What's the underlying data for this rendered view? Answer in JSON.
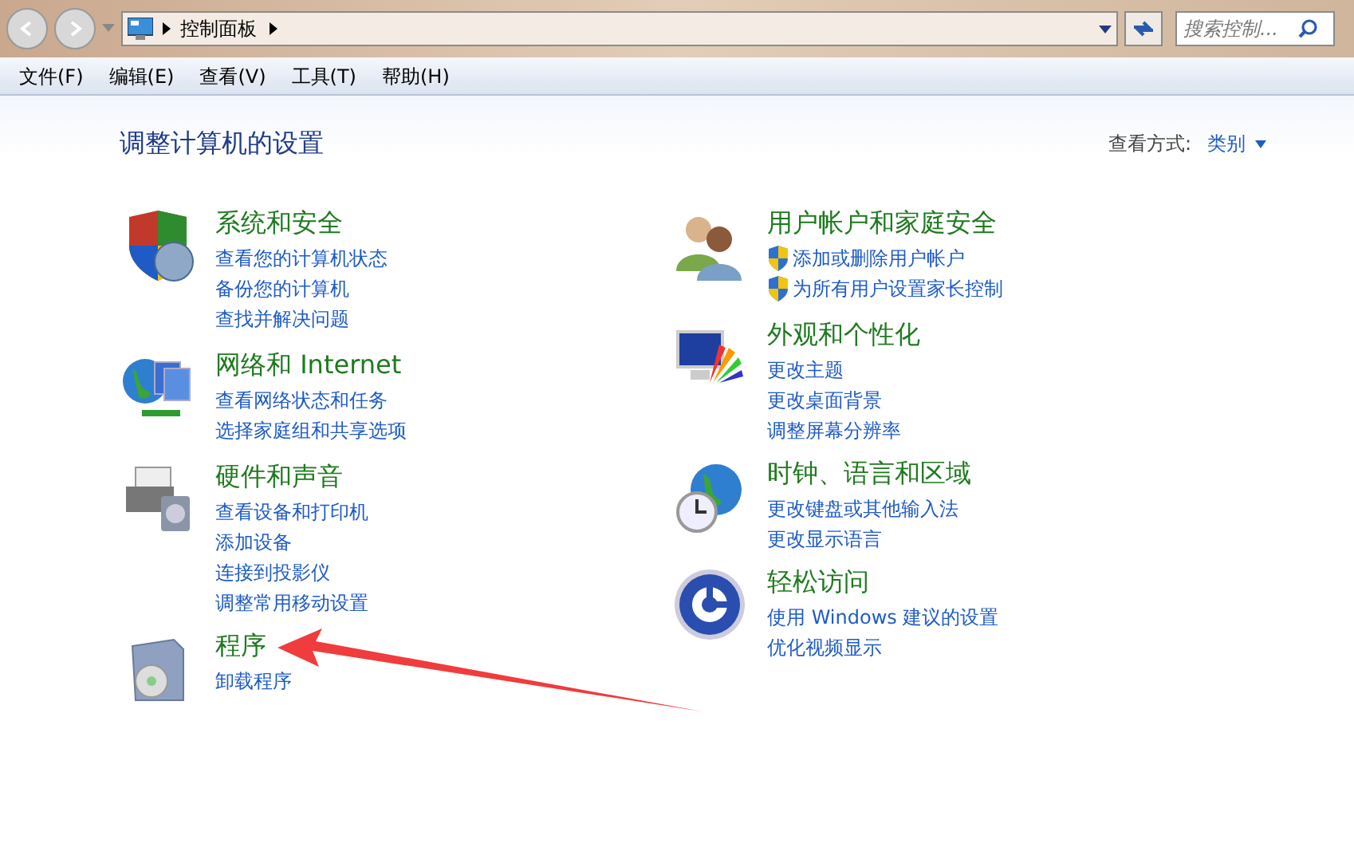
{
  "address_bar": {
    "breadcrumb": [
      "控制面板"
    ]
  },
  "search": {
    "placeholder": "搜索控制..."
  },
  "menu": [
    "文件(F)",
    "编辑(E)",
    "查看(V)",
    "工具(T)",
    "帮助(H)"
  ],
  "heading": "调整计算机的设置",
  "view_by": {
    "label": "查看方式:",
    "value": "类别"
  },
  "columns": [
    [
      {
        "title": "系统和安全",
        "links": [
          {
            "text": "查看您的计算机状态",
            "kind": "plain"
          },
          {
            "text": "备份您的计算机",
            "kind": "plain"
          },
          {
            "text": "查找并解决问题",
            "kind": "plain"
          }
        ]
      },
      {
        "title": "网络和 Internet",
        "links": [
          {
            "text": "查看网络状态和任务",
            "kind": "plain"
          },
          {
            "text": "选择家庭组和共享选项",
            "kind": "plain"
          }
        ]
      },
      {
        "title": "硬件和声音",
        "links": [
          {
            "text": "查看设备和打印机",
            "kind": "plain"
          },
          {
            "text": "添加设备",
            "kind": "plain"
          },
          {
            "text": "连接到投影仪",
            "kind": "plain"
          },
          {
            "text": "调整常用移动设置",
            "kind": "plain"
          }
        ]
      },
      {
        "title": "程序",
        "links": [
          {
            "text": "卸载程序",
            "kind": "plain"
          }
        ]
      }
    ],
    [
      {
        "title": "用户帐户和家庭安全",
        "links": [
          {
            "text": "添加或删除用户帐户",
            "kind": "shield"
          },
          {
            "text": "为所有用户设置家长控制",
            "kind": "shield"
          }
        ]
      },
      {
        "title": "外观和个性化",
        "links": [
          {
            "text": "更改主题",
            "kind": "plain"
          },
          {
            "text": "更改桌面背景",
            "kind": "plain"
          },
          {
            "text": "调整屏幕分辨率",
            "kind": "plain"
          }
        ]
      },
      {
        "title": "时钟、语言和区域",
        "links": [
          {
            "text": "更改键盘或其他输入法",
            "kind": "plain"
          },
          {
            "text": "更改显示语言",
            "kind": "plain"
          }
        ]
      },
      {
        "title": "轻松访问",
        "links": [
          {
            "text": "使用 Windows 建议的设置",
            "kind": "plain"
          },
          {
            "text": "优化视频显示",
            "kind": "plain"
          }
        ]
      }
    ]
  ]
}
